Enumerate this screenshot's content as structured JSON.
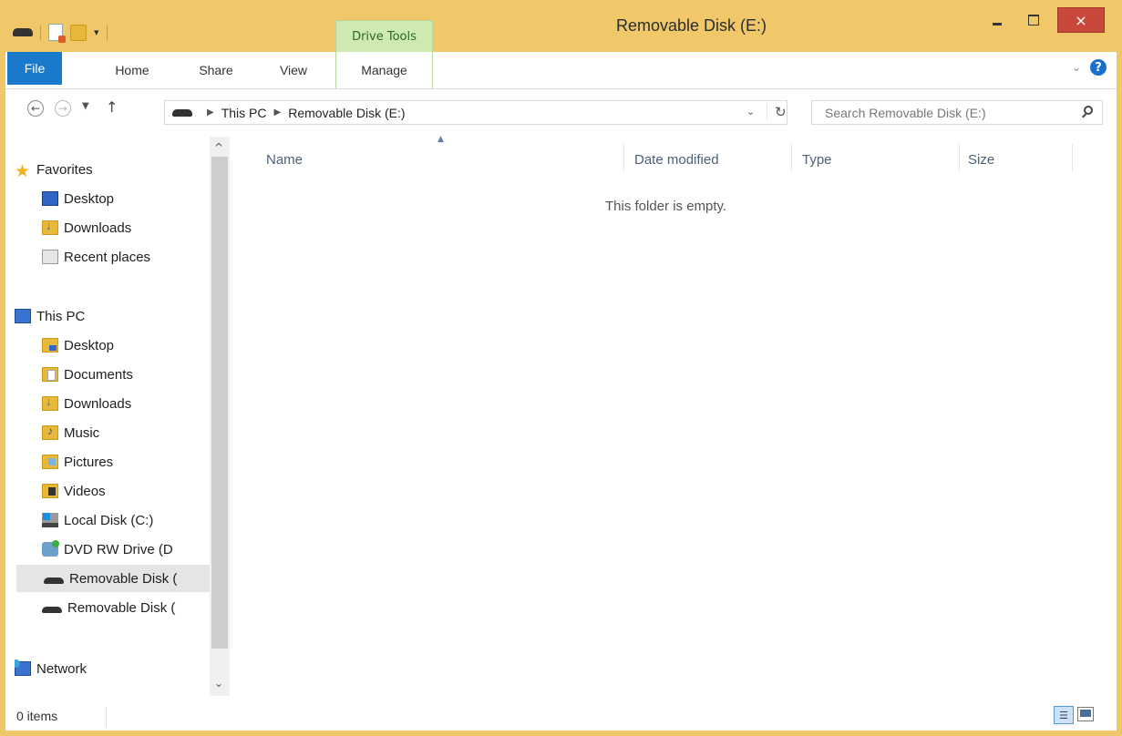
{
  "window": {
    "title": "Removable Disk (E:)",
    "contextual_group": "Drive Tools",
    "close_glyph": "×"
  },
  "quick_access": {
    "dropdown_glyph": "▾"
  },
  "ribbon": {
    "tabs": [
      "File",
      "Home",
      "Share",
      "View",
      "Manage"
    ],
    "expand_glyph": "⌄",
    "help_glyph": "?"
  },
  "navigation": {
    "back_glyph": "←",
    "forward_glyph": "→",
    "recent_glyph": "▼",
    "up_glyph": "↑",
    "breadcrumb": [
      "This PC",
      "Removable Disk (E:)"
    ],
    "crumb_separator": "▶",
    "address_dropdown_glyph": "⌄",
    "refresh_glyph": "↻",
    "search_placeholder": "Search Removable Disk (E:)"
  },
  "nav_pane": {
    "scroll_up_glyph": "^",
    "scroll_down_glyph": "⌄",
    "favorites": {
      "label": "Favorites",
      "star_glyph": "★",
      "items": [
        "Desktop",
        "Downloads",
        "Recent places"
      ]
    },
    "this_pc": {
      "label": "This PC",
      "items": [
        "Desktop",
        "Documents",
        "Downloads",
        "Music",
        "Pictures",
        "Videos",
        "Local Disk (C:)",
        "DVD RW Drive (D",
        "Removable Disk (",
        "Removable Disk ("
      ]
    },
    "network": {
      "label": "Network"
    }
  },
  "content": {
    "columns": [
      "Name",
      "Date modified",
      "Type",
      "Size"
    ],
    "sort_glyph": "▲",
    "empty_message": "This folder is empty."
  },
  "status": {
    "items_text": "0 items",
    "details_glyph": "☰"
  },
  "colors": {
    "title_bar": "#f0c869",
    "file_tab": "#1979ca",
    "contextual_tab": "#cfe9b2",
    "close_button": "#c9483c",
    "selection": "#e5e5e5"
  }
}
